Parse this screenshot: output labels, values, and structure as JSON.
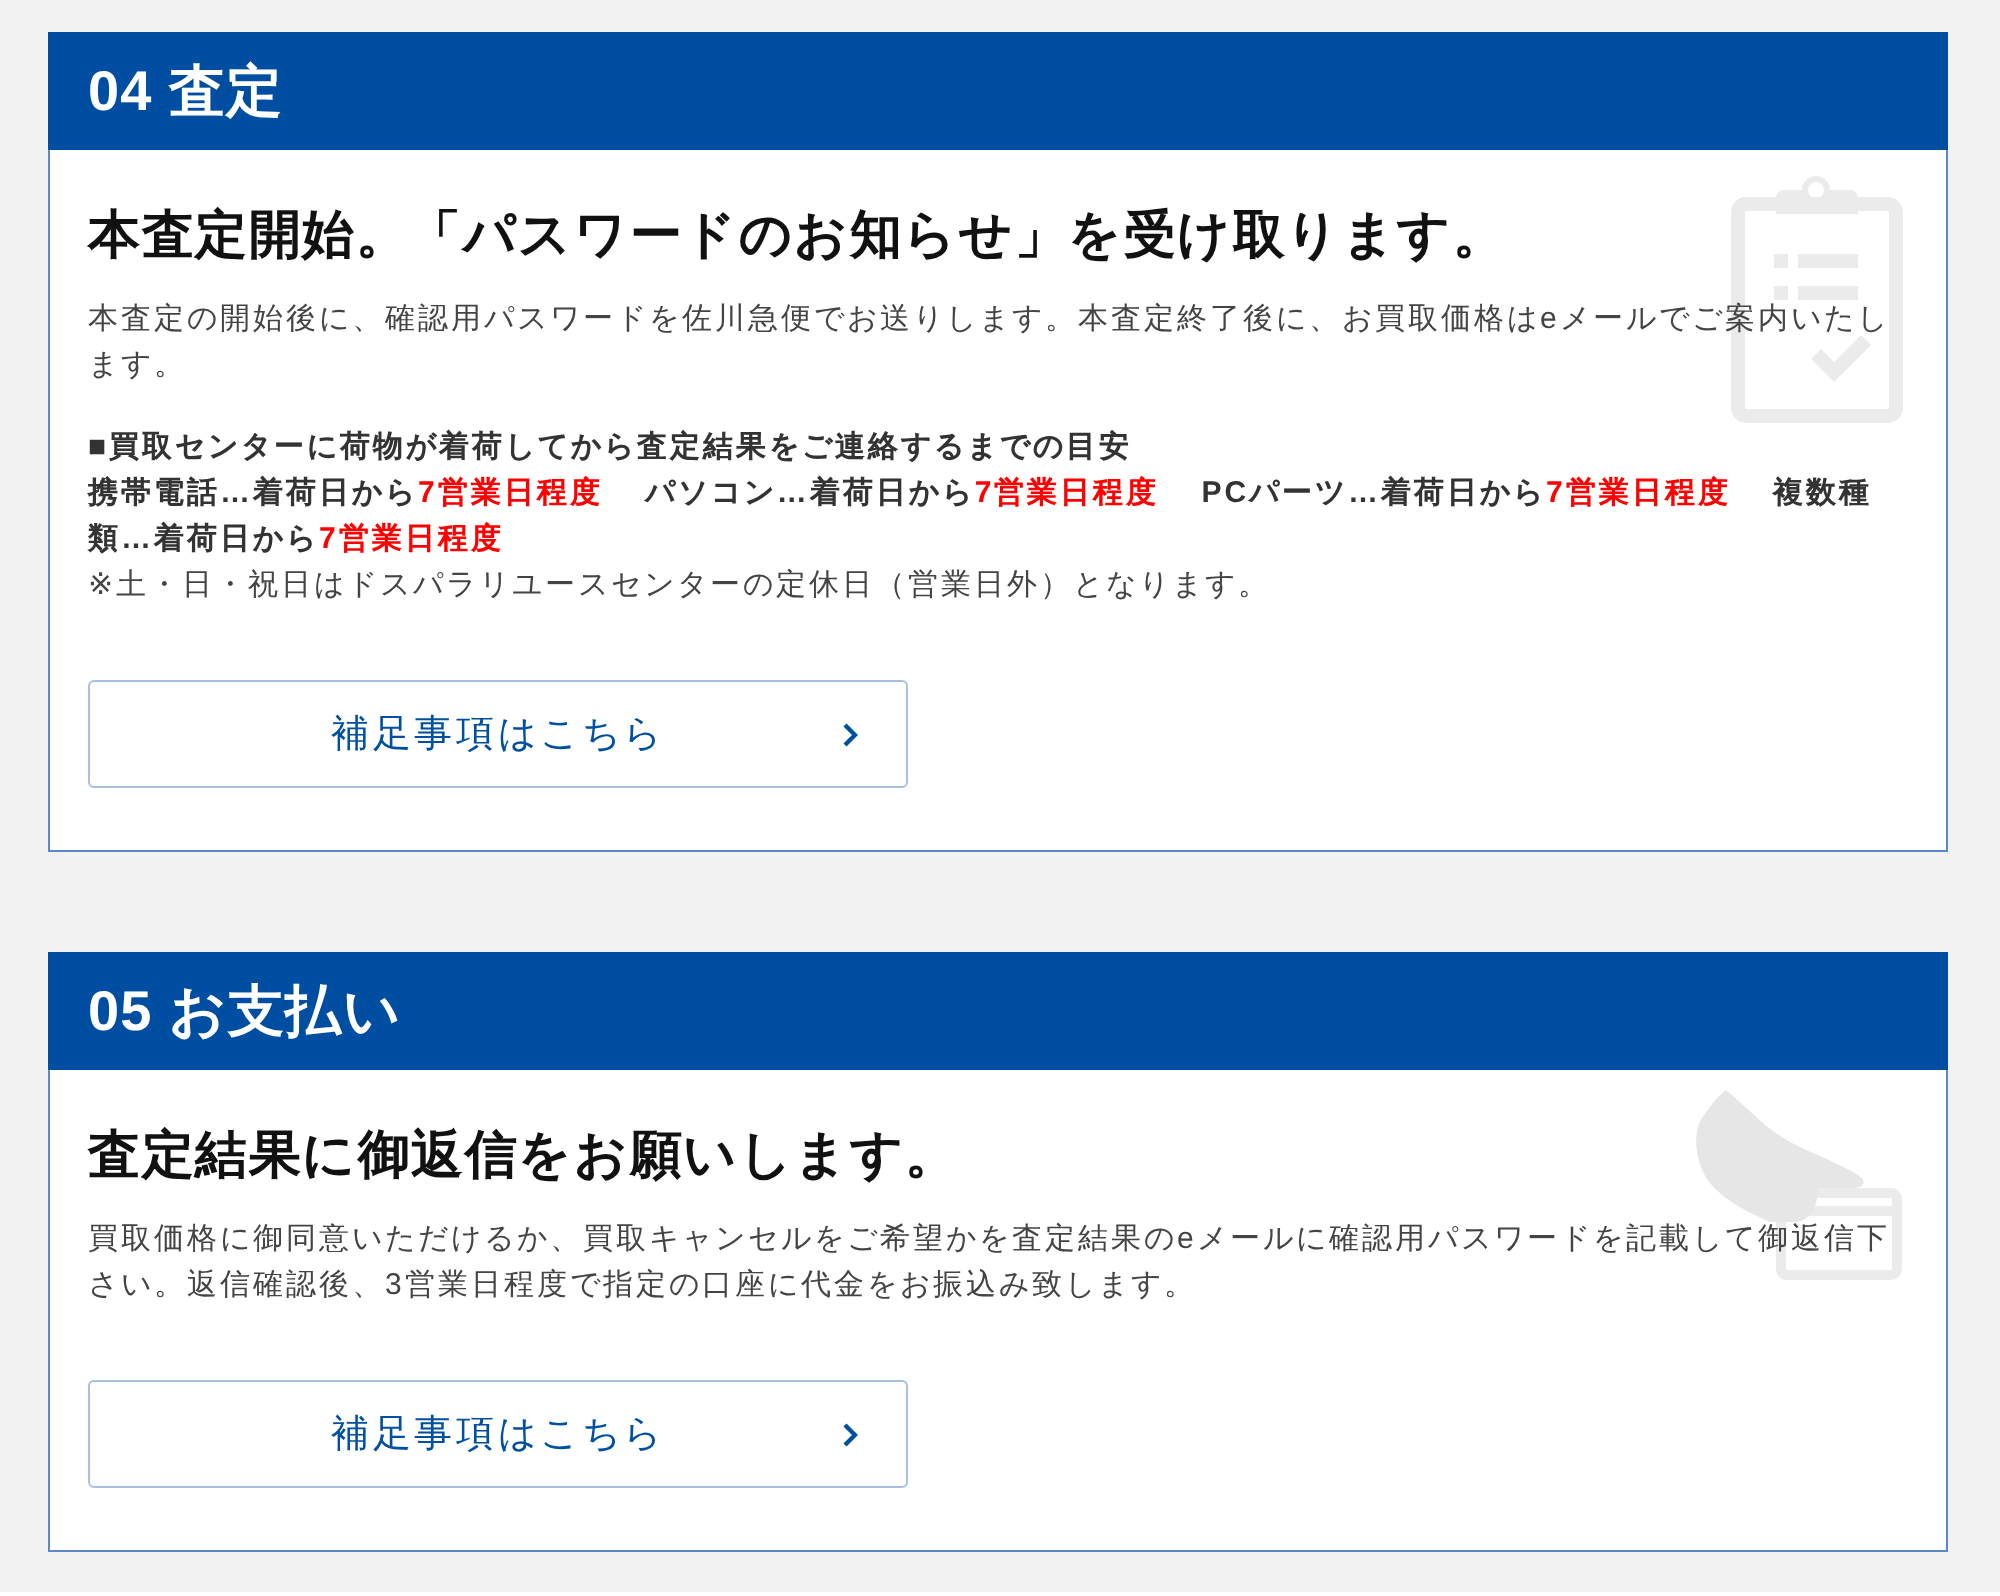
{
  "steps": [
    {
      "heading": "04 査定",
      "title": "本査定開始。「パスワードのお知らせ」を受け取ります。",
      "description": "本査定の開始後に、確認用パスワードを佐川急便でお送りします。本査定終了後に、お買取価格はeメールでご案内いたします。",
      "turnaround": {
        "heading": "■買取センターに荷物が着荷してから査定結果をご連絡するまでの目安",
        "items": [
          {
            "label": "携帯電話…着荷日から",
            "time": "7営業日程度"
          },
          {
            "label": "パソコン…着荷日から",
            "time": "7営業日程度"
          },
          {
            "label": "PCパーツ…着荷日から",
            "time": "7営業日程度"
          },
          {
            "label": "複数種類…着荷日から",
            "time": "7営業日程度"
          }
        ],
        "note": "※土・日・祝日はドスパラリユースセンターの定休日（営業日外）となります。"
      },
      "button_label": "補足事項はこちら"
    },
    {
      "heading": "05 お支払い",
      "title": "査定結果に御返信をお願いします。",
      "description": "買取価格に御同意いただけるか、買取キャンセルをご希望かを査定結果のeメールに確認用パスワードを記載して御返信下さい。返信確認後、3営業日程度で指定の口座に代金をお振込み致します。",
      "button_label": "補足事項はこちら"
    }
  ]
}
